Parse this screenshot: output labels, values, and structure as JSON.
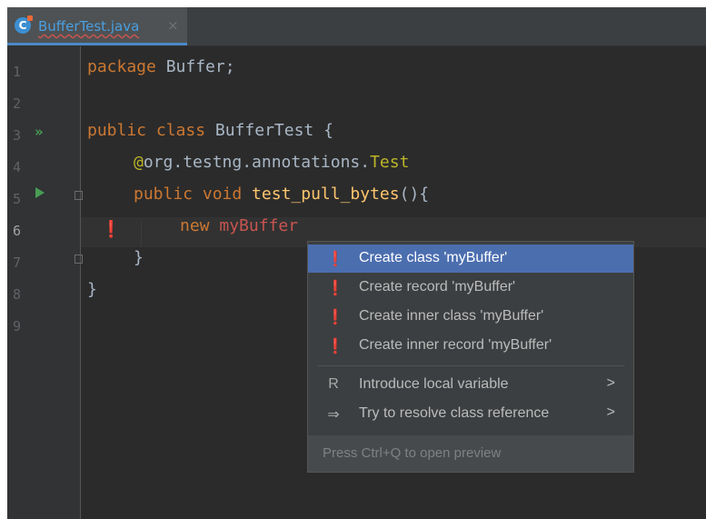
{
  "tab": {
    "filename": "BufferTest.java",
    "close": "×",
    "icon": "C"
  },
  "line_numbers": [
    "1",
    "2",
    "3",
    "4",
    "5",
    "6",
    "7",
    "8",
    "9"
  ],
  "code": {
    "l1_kw": "package",
    "l1_rest": " Buffer;",
    "l3_kw": "public class",
    "l3_rest": " BufferTest {",
    "l4_at": "@",
    "l4_path": "org.testng.annotations.",
    "l4_ann": "Test",
    "l5_kw": "public void",
    "l5_fn": " test_pull_bytes",
    "l5_rest": "(){",
    "l6_kw": "new",
    "l6_err": " myBuffer",
    "l7": "}",
    "l8": "}"
  },
  "popup": {
    "items": [
      {
        "label": "Create class 'myBuffer'",
        "icon": "bulb-error-icon"
      },
      {
        "label": "Create record 'myBuffer'",
        "icon": "bulb-error-icon"
      },
      {
        "label": "Create inner class 'myBuffer'",
        "icon": "bulb-error-icon"
      },
      {
        "label": "Create inner record 'myBuffer'",
        "icon": "bulb-error-icon"
      },
      {
        "label": "Introduce local variable",
        "icon": "refactor-icon",
        "arrow": ">"
      },
      {
        "label": "Try to resolve class reference",
        "icon": "resolve-icon",
        "arrow": ">"
      }
    ],
    "footer": "Press Ctrl+Q to open preview"
  },
  "colors": {
    "editor_bg": "#2b2b2b",
    "keyword": "#cc7832",
    "annotation": "#bbb529",
    "function": "#ffc66d",
    "error": "#c75450",
    "selection": "#4b6eaf"
  }
}
